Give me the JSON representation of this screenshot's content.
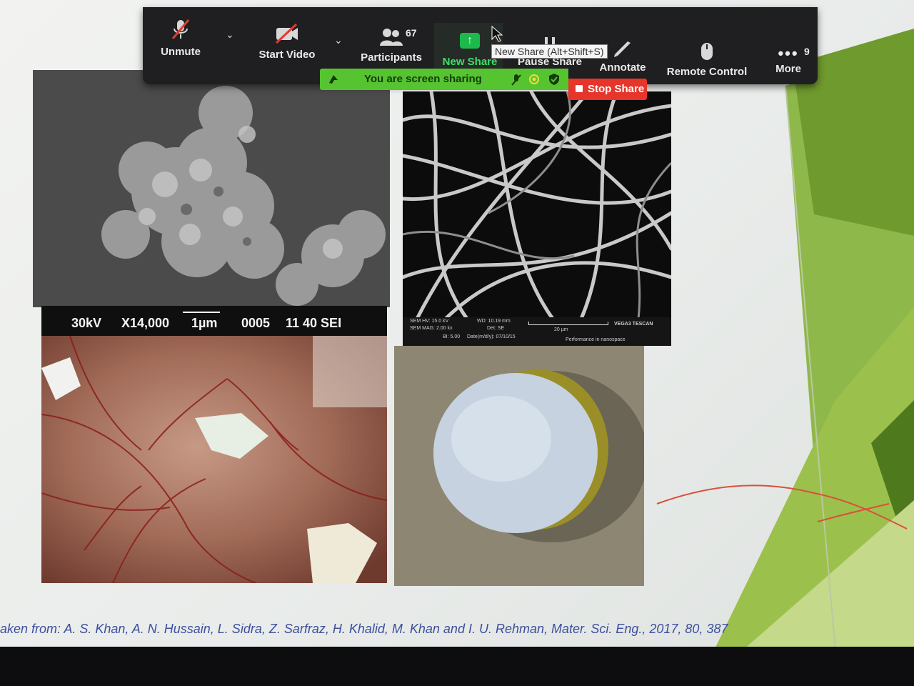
{
  "toolbar": {
    "unmute_label": "Unmute",
    "start_video_label": "Start Video",
    "participants_label": "Participants",
    "participants_count": "67",
    "new_share_label": "New Share",
    "pause_share_label": "Pause Share",
    "annotate_label": "Annotate",
    "remote_control_label": "Remote Control",
    "more_label": "More",
    "more_badge": "9",
    "tooltip": "New Share (Alt+Shift+S)"
  },
  "share_banner": {
    "text": "You are screen sharing",
    "stop_label": "Stop Share"
  },
  "sem_image": {
    "voltage": "30kV",
    "magnification": "X14,000",
    "scale": "1µm",
    "code": "0005",
    "detector": "11 40 SEI"
  },
  "fiber_image": {
    "sem_hv": "SEM HV: 15.0 kV",
    "sem_mag": "SEM MAG: 2.00 kx",
    "bi": "BI: 5.00",
    "wd": "WD: 10.19 mm",
    "det": "Det: SE",
    "date": "Date(m/d/y): 07/10/15",
    "scale": "20 µm",
    "brand": "VEGA3 TESCAN",
    "tagline": "Performance in nanospace"
  },
  "citation": "aken from: A. S. Khan, A. N. Hussain, L. Sidra, Z. Sarfraz, H. Khalid, M. Khan and I. U. Rehman, Mater. Sci. Eng., 2017, 80, 387",
  "colors": {
    "toolbar_bg": "#1f1f21",
    "share_green": "#56c431",
    "stop_red": "#e6352b",
    "new_share_green": "#1db94d",
    "citation_blue": "#3d4f9c"
  }
}
